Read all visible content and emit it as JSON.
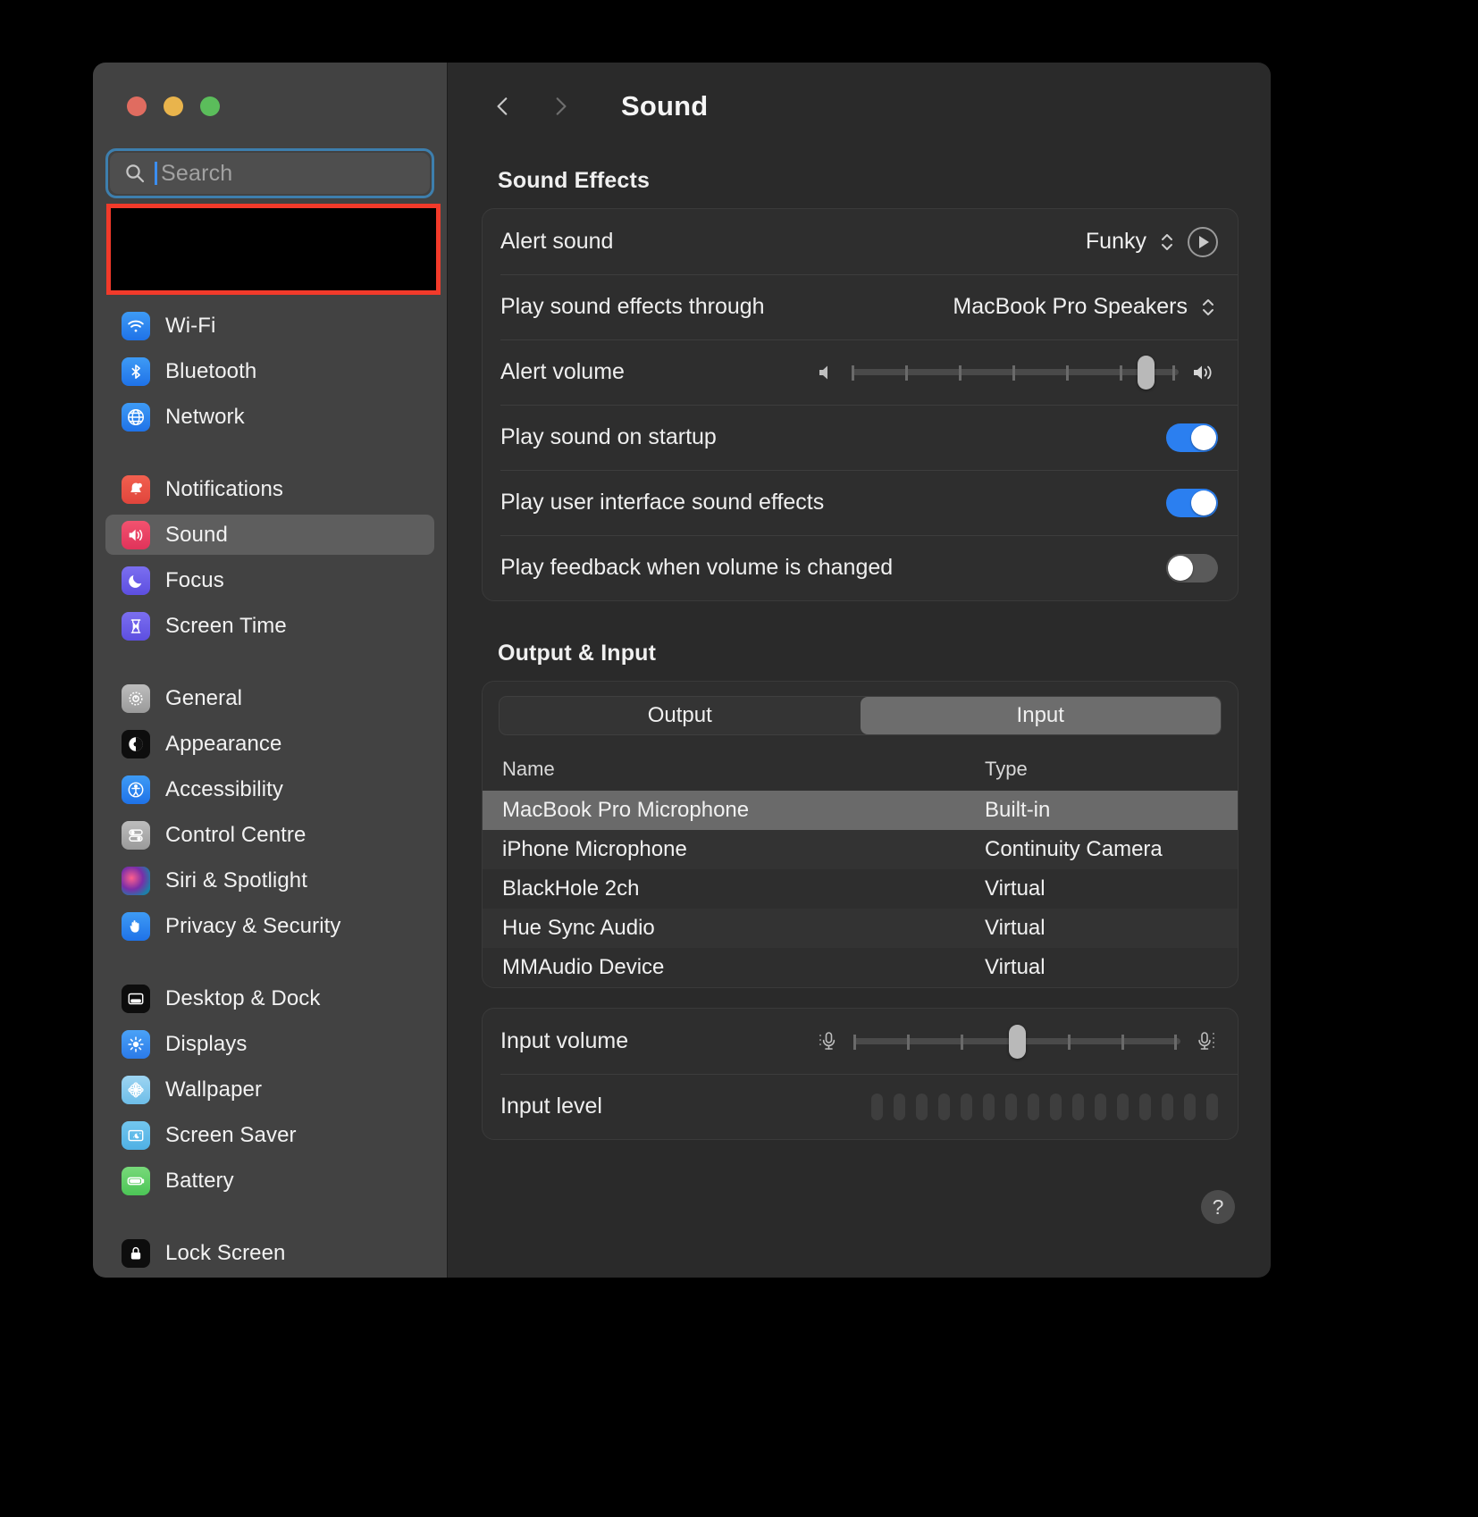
{
  "window": {
    "traffic_lights": [
      "close-red",
      "minimize-yellow",
      "zoom-green"
    ]
  },
  "search": {
    "placeholder": "Search",
    "value": "",
    "icon": "search-icon"
  },
  "sidebar": {
    "groups": [
      {
        "items": [
          {
            "label": "Wi-Fi",
            "icon": "wifi-icon",
            "selected": false
          },
          {
            "label": "Bluetooth",
            "icon": "bluetooth-icon",
            "selected": false
          },
          {
            "label": "Network",
            "icon": "network-globe-icon",
            "selected": false
          }
        ]
      },
      {
        "items": [
          {
            "label": "Notifications",
            "icon": "notifications-bell-icon",
            "selected": false
          },
          {
            "label": "Sound",
            "icon": "sound-speaker-icon",
            "selected": true
          },
          {
            "label": "Focus",
            "icon": "focus-moon-icon",
            "selected": false
          },
          {
            "label": "Screen Time",
            "icon": "screen-time-hourglass-icon",
            "selected": false
          }
        ]
      },
      {
        "items": [
          {
            "label": "General",
            "icon": "general-gear-icon",
            "selected": false
          },
          {
            "label": "Appearance",
            "icon": "appearance-contrast-icon",
            "selected": false
          },
          {
            "label": "Accessibility",
            "icon": "accessibility-person-icon",
            "selected": false
          },
          {
            "label": "Control Centre",
            "icon": "control-centre-toggles-icon",
            "selected": false
          },
          {
            "label": "Siri & Spotlight",
            "icon": "siri-orb-icon",
            "selected": false
          },
          {
            "label": "Privacy & Security",
            "icon": "privacy-hand-icon",
            "selected": false
          }
        ]
      },
      {
        "items": [
          {
            "label": "Desktop & Dock",
            "icon": "desktop-dock-icon",
            "selected": false
          },
          {
            "label": "Displays",
            "icon": "displays-brightness-icon",
            "selected": false
          },
          {
            "label": "Wallpaper",
            "icon": "wallpaper-flower-icon",
            "selected": false
          },
          {
            "label": "Screen Saver",
            "icon": "screen-saver-icon",
            "selected": false
          },
          {
            "label": "Battery",
            "icon": "battery-icon",
            "selected": false
          }
        ]
      },
      {
        "items": [
          {
            "label": "Lock Screen",
            "icon": "lock-screen-icon",
            "selected": false
          }
        ]
      }
    ]
  },
  "header": {
    "title": "Sound",
    "back_icon": "chevron-left-icon",
    "forward_icon": "chevron-right-icon"
  },
  "sound_effects": {
    "section_title": "Sound Effects",
    "alert_sound": {
      "label": "Alert sound",
      "value": "Funky",
      "stepper_icon": "chevron-up-down-icon",
      "play_icon": "play-circle-icon"
    },
    "play_through": {
      "label": "Play sound effects through",
      "value": "MacBook Pro Speakers",
      "stepper_icon": "chevron-up-down-icon"
    },
    "alert_volume": {
      "label": "Alert volume",
      "value_percent": 90,
      "left_icon": "speaker-low-icon",
      "right_icon": "speaker-high-icon",
      "ticks": 7
    },
    "toggles": [
      {
        "label": "Play sound on startup",
        "on": true
      },
      {
        "label": "Play user interface sound effects",
        "on": true
      },
      {
        "label": "Play feedback when volume is changed",
        "on": false
      }
    ]
  },
  "output_input": {
    "section_title": "Output & Input",
    "tabs": [
      {
        "label": "Output",
        "active": false
      },
      {
        "label": "Input",
        "active": true
      }
    ],
    "table": {
      "columns": [
        "Name",
        "Type"
      ],
      "rows": [
        {
          "name": "MacBook Pro Microphone",
          "type": "Built-in",
          "selected": true
        },
        {
          "name": "iPhone Microphone",
          "type": "Continuity Camera",
          "selected": false
        },
        {
          "name": "BlackHole 2ch",
          "type": "Virtual",
          "selected": false
        },
        {
          "name": "Hue Sync Audio",
          "type": "Virtual",
          "selected": false
        },
        {
          "name": "MMAudio Device",
          "type": "Virtual",
          "selected": false
        }
      ]
    },
    "input_volume": {
      "label": "Input volume",
      "value_percent": 50,
      "left_icon": "microphone-low-icon",
      "right_icon": "microphone-high-icon",
      "ticks": 7
    },
    "input_level": {
      "label": "Input level",
      "segments": 16,
      "active_segments": 0
    }
  },
  "help": {
    "label": "?",
    "icon": "help-icon"
  },
  "colors": {
    "window_bg": "#2a2a2a",
    "sidebar_bg": "#424242",
    "accent_blue": "#2b7ff0",
    "focus_ring": "#3d7fae",
    "annotation_red": "#f23a2a",
    "selected_row": "#6a6a6a"
  }
}
